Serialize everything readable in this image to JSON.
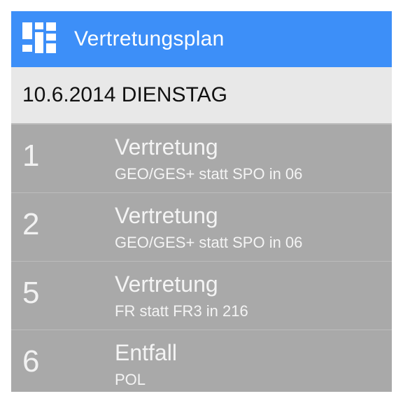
{
  "app": {
    "title": "Vertretungsplan",
    "icon": "app-logo-icon",
    "colors": {
      "appbar": "#3d8ff8",
      "header_bg": "#e8e8e8",
      "list_bg": "#a9a9a9"
    }
  },
  "date_header": {
    "label": "10.6.2014 DIENSTAG"
  },
  "entries": [
    {
      "period": "1",
      "type": "Vertretung",
      "detail": "GEO/GES+ statt SPO in 06"
    },
    {
      "period": "2",
      "type": "Vertretung",
      "detail": "GEO/GES+ statt SPO in 06"
    },
    {
      "period": "5",
      "type": "Vertretung",
      "detail": "FR statt FR3 in 216"
    },
    {
      "period": "6",
      "type": "Entfall",
      "detail": "POL"
    }
  ]
}
